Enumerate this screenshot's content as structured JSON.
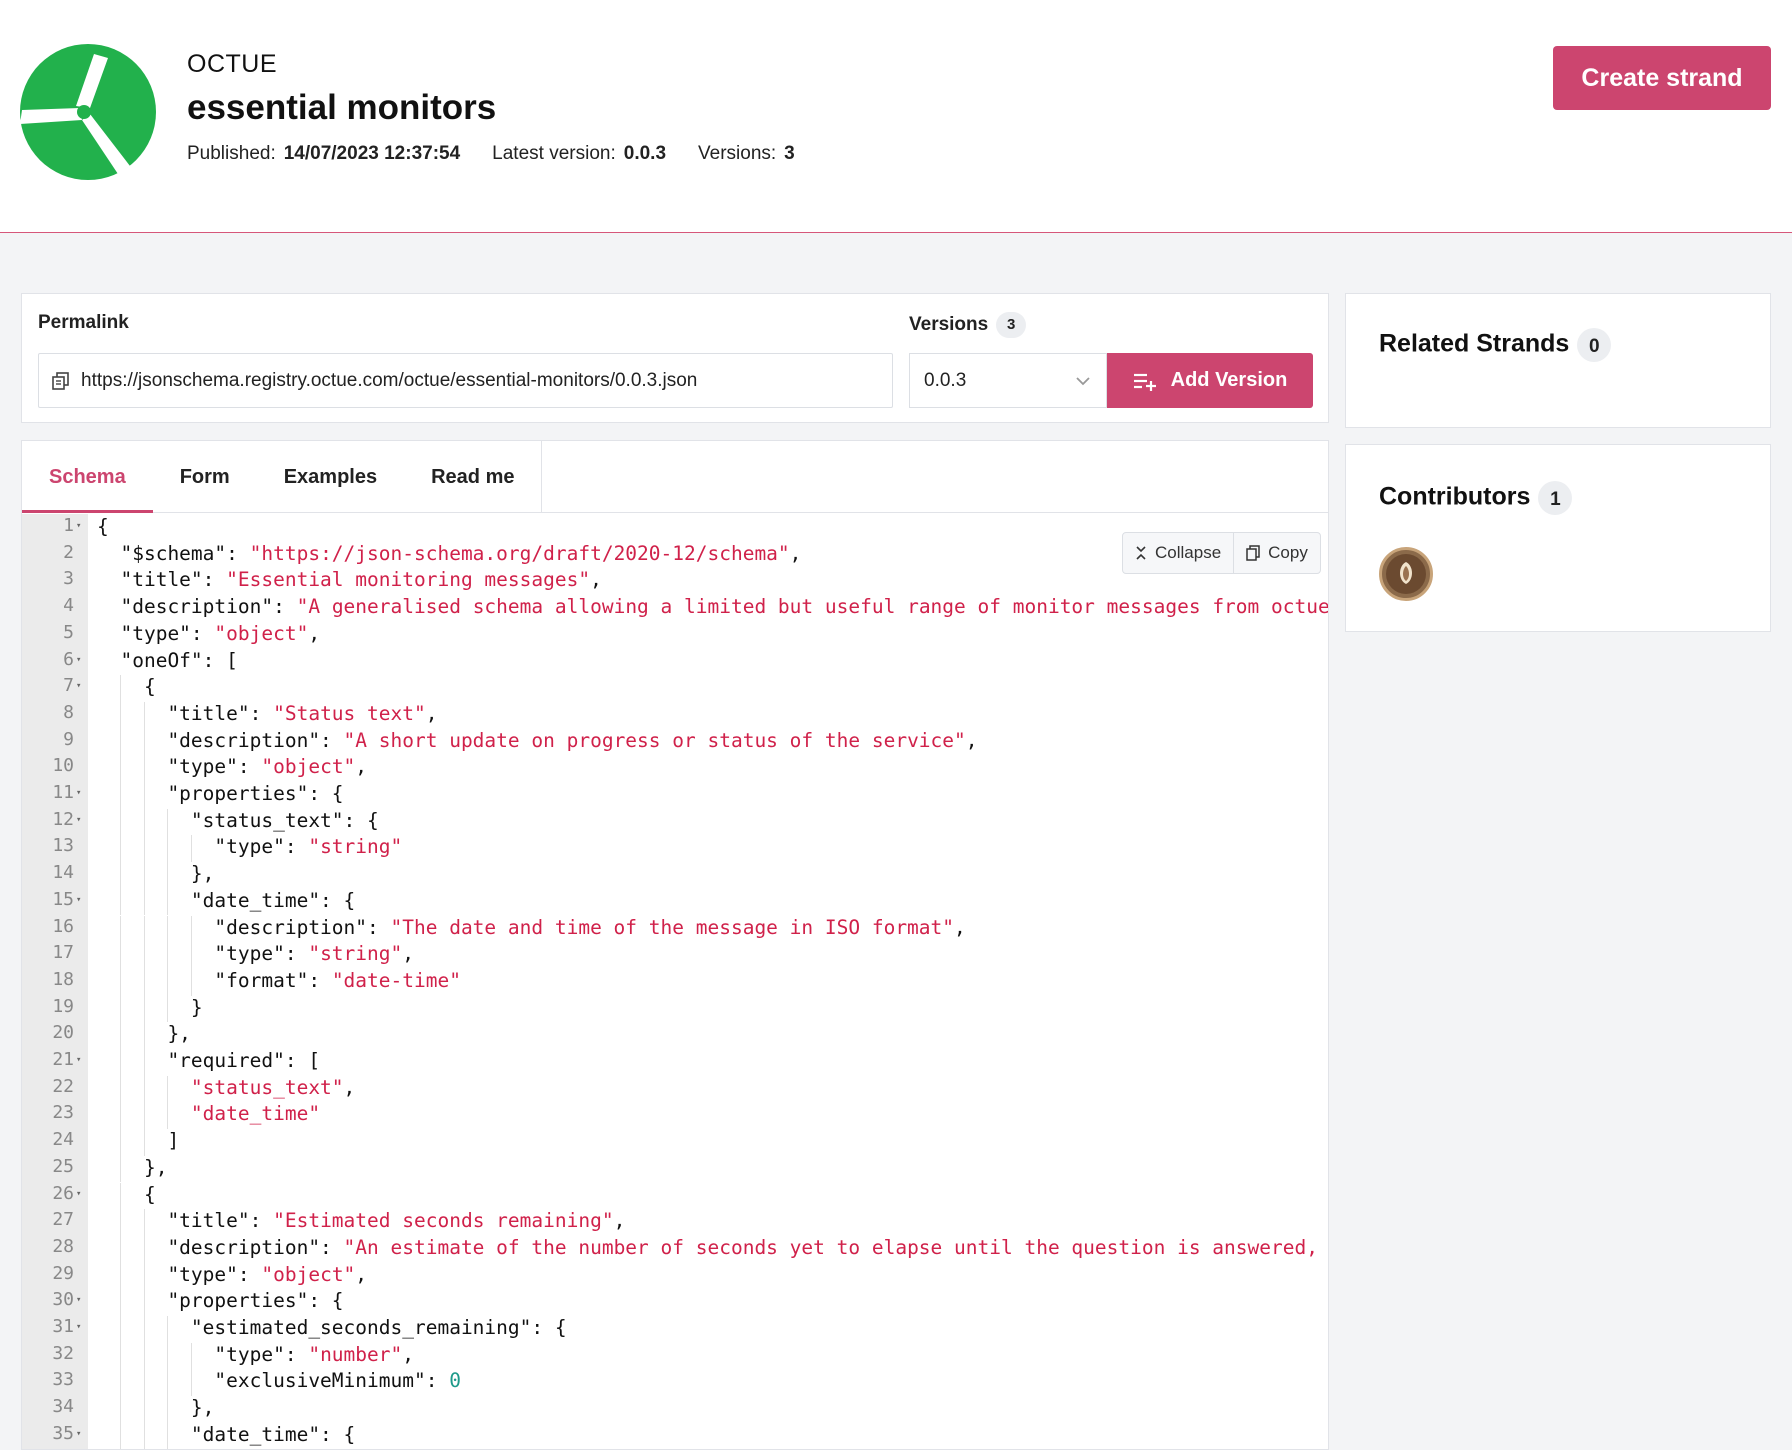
{
  "header": {
    "org": "OCTUE",
    "title": "essential monitors",
    "published_label": "Published:",
    "published_value": "14/07/2023 12:37:54",
    "latest_label": "Latest version:",
    "latest_value": "0.0.3",
    "versions_label": "Versions:",
    "versions_value": "3",
    "create_button": "Create strand",
    "accent_color": "#cc456f",
    "logo_color": "#22b14c"
  },
  "permalink": {
    "label": "Permalink",
    "url": "https://jsonschema.registry.octue.com/octue/essential-monitors/0.0.3.json",
    "versions_label": "Versions",
    "versions_count": "3",
    "selected_version": "0.0.3",
    "add_version_button": "Add Version"
  },
  "tabs": [
    {
      "label": "Schema",
      "active": true
    },
    {
      "label": "Form",
      "active": false
    },
    {
      "label": "Examples",
      "active": false
    },
    {
      "label": "Read me",
      "active": false
    }
  ],
  "code_actions": {
    "collapse": "Collapse",
    "copy": "Copy"
  },
  "code_lines": [
    "{",
    "  \"$schema\": \"https://json-schema.org/draft/2020-12/schema\",",
    "  \"title\": \"Essential monitoring messages\",",
    "  \"description\": \"A generalised schema allowing a limited but useful range of monitor messages from octue serv",
    "  \"type\": \"object\",",
    "  \"oneOf\": [",
    "    {",
    "      \"title\": \"Status text\",",
    "      \"description\": \"A short update on progress or status of the service\",",
    "      \"type\": \"object\",",
    "      \"properties\": {",
    "        \"status_text\": {",
    "          \"type\": \"string\"",
    "        },",
    "        \"date_time\": {",
    "          \"description\": \"The date and time of the message in ISO format\",",
    "          \"type\": \"string\",",
    "          \"format\": \"date-time\"",
    "        }",
    "      },",
    "      \"required\": [",
    "        \"status_text\",",
    "        \"date_time\"",
    "      ]",
    "    },",
    "    {",
    "      \"title\": \"Estimated seconds remaining\",",
    "      \"description\": \"An estimate of the number of seconds yet to elapse until the question is answered, useful",
    "      \"type\": \"object\",",
    "      \"properties\": {",
    "        \"estimated_seconds_remaining\": {",
    "          \"type\": \"number\",",
    "          \"exclusiveMinimum\": 0",
    "        },",
    "        \"date_time\": {"
  ],
  "fold_lines": [
    1,
    6,
    7,
    11,
    12,
    15,
    21,
    26,
    30,
    31,
    35
  ],
  "related_strands": {
    "title": "Related Strands",
    "count": "0"
  },
  "contributors": {
    "title": "Contributors",
    "count": "1"
  }
}
